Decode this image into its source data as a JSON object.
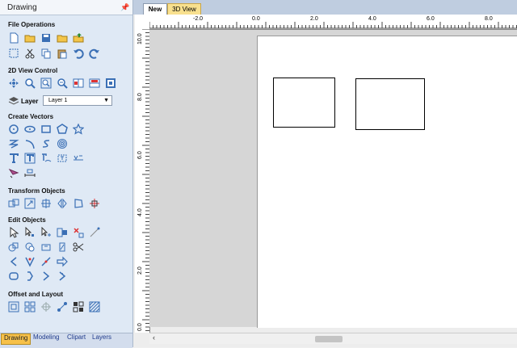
{
  "panel": {
    "title": "Drawing",
    "pin_icon": "pin-icon",
    "sections": {
      "file_ops": "File Operations",
      "view_2d": "2D View Control",
      "create_vectors": "Create Vectors",
      "transform": "Transform Objects",
      "edit": "Edit Objects",
      "offset": "Offset and Layout"
    },
    "layer_label": "Layer",
    "layer_value": "Layer 1"
  },
  "bottom_tabs": [
    "Drawing",
    "Modeling",
    "Clipart",
    "Layers"
  ],
  "doc_tabs": [
    "New",
    "3D View"
  ],
  "ruler": {
    "top_labels": [
      "-2.0",
      "0.0",
      "2.0",
      "4.0",
      "6.0",
      "8.0"
    ],
    "left_labels": [
      "10.0",
      "8.0",
      "6.0",
      "4.0",
      "2.0",
      "0.0"
    ]
  },
  "colors": {
    "panel_bg": "#dfe9f5",
    "active_tab": "#f7c14a",
    "tab_3d": "#f8e08e",
    "accent_blue": "#1f5fbf"
  }
}
